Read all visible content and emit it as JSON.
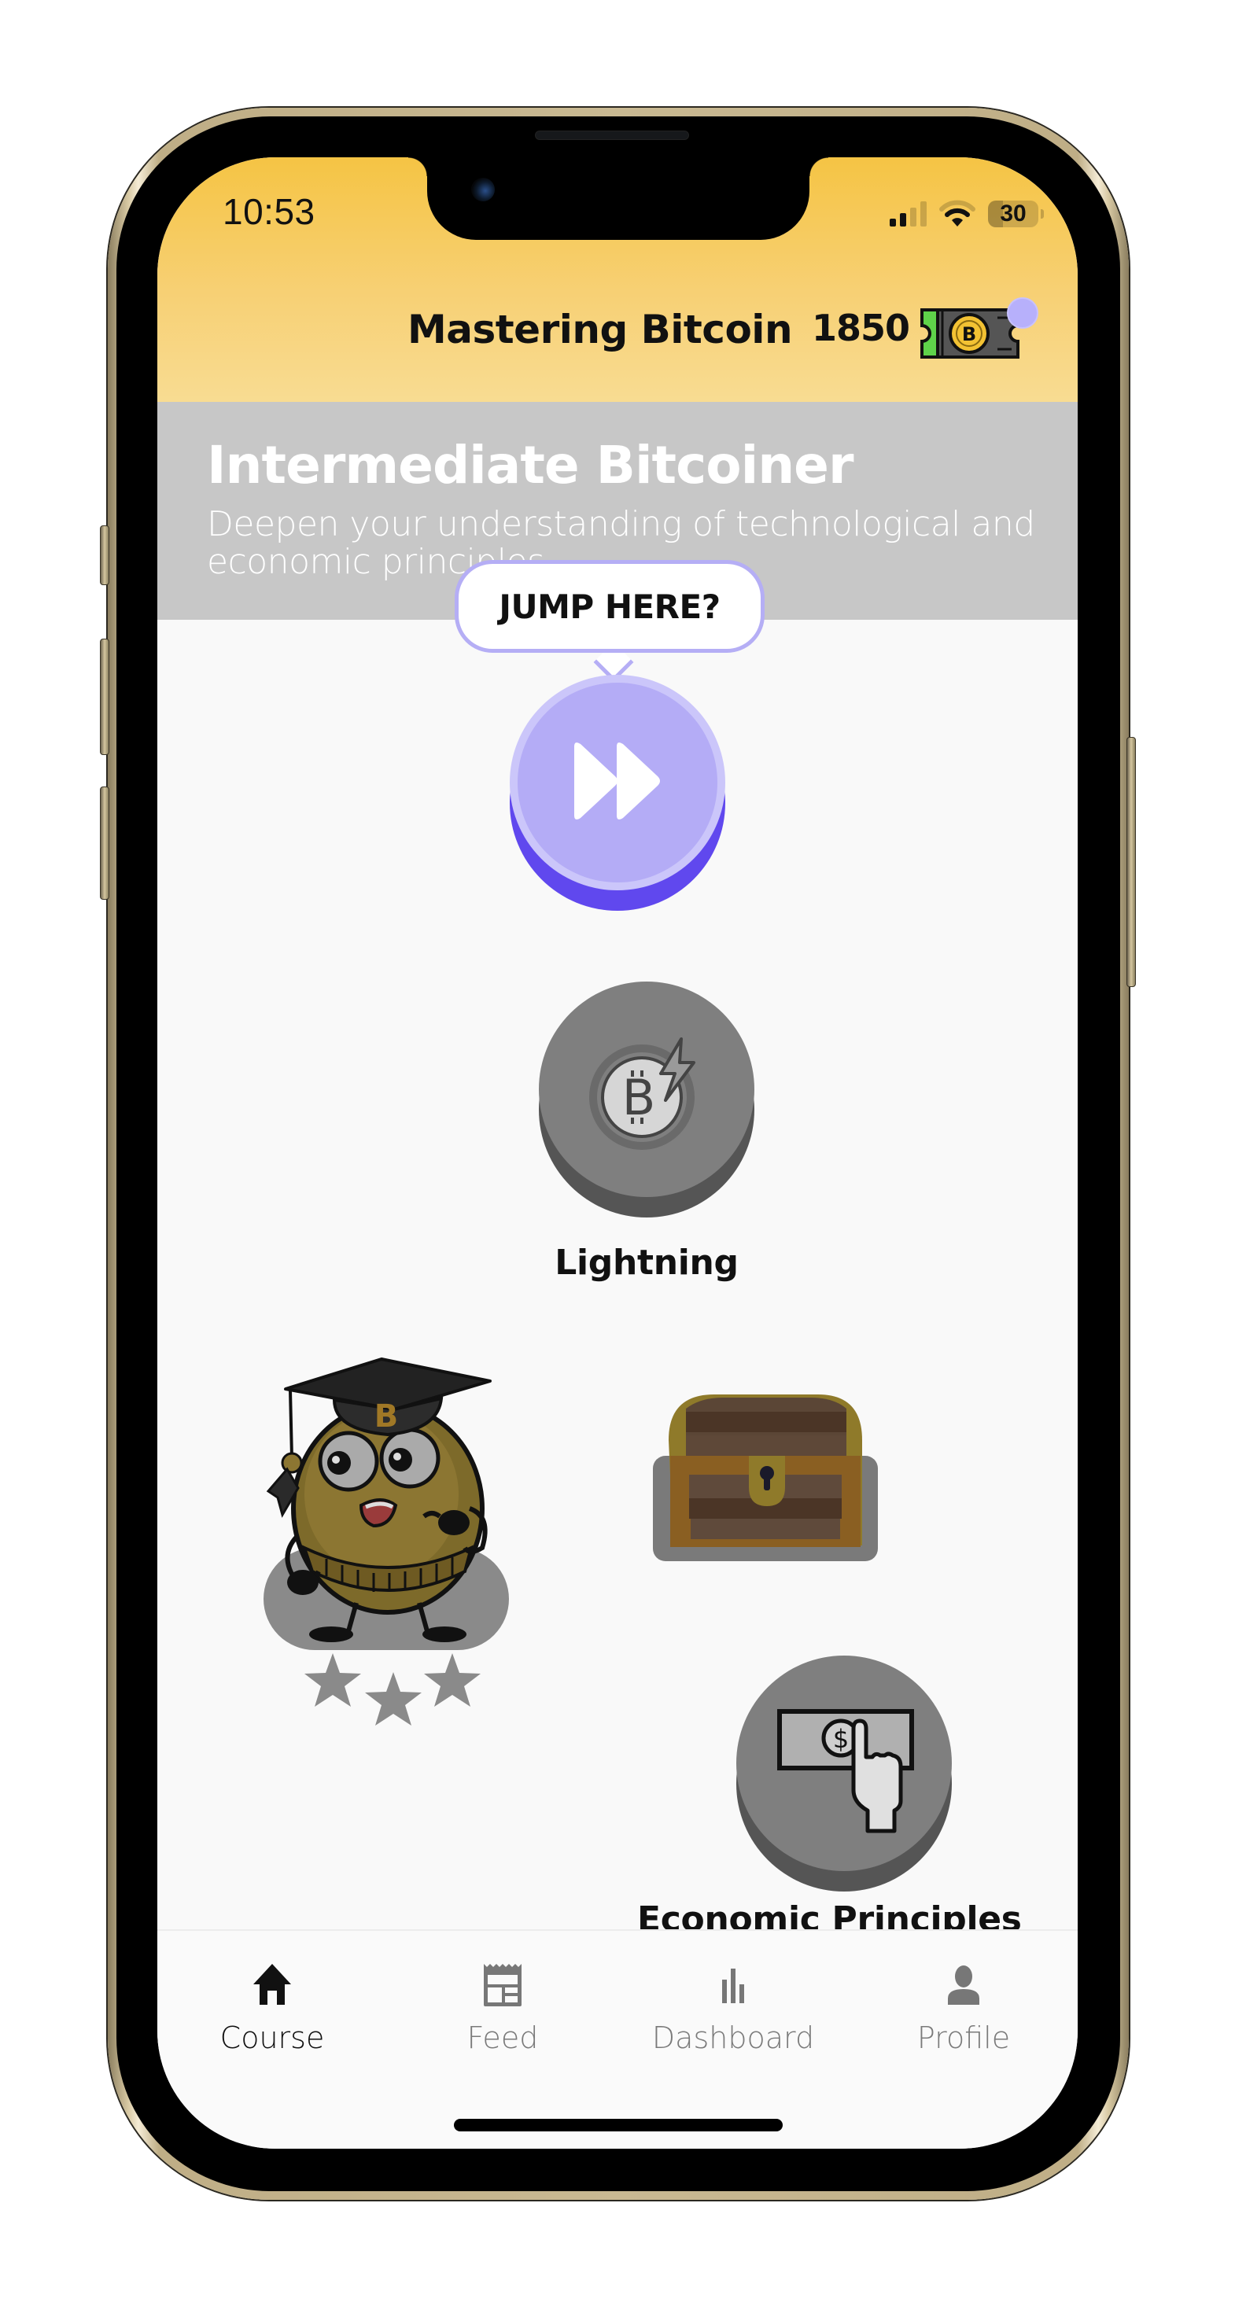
{
  "status_bar": {
    "time": "10:53",
    "battery_level": "30",
    "signal_bars_active": 2,
    "signal_bars_total": 4,
    "wifi": "wifi-icon"
  },
  "header": {
    "course_title": "Mastering Bitcoin",
    "points": "1850",
    "ticket_icon": "bitcoin-ticket-icon",
    "notification_dot_color": "#b7b0fb"
  },
  "banner": {
    "title": "Intermediate Bitcoiner",
    "subtitle": "Deepen your understanding of technological and economic principles."
  },
  "path": {
    "jump_bubble": "JUMP HERE?",
    "jump_icon": "fast-forward-icon",
    "nodes": [
      {
        "label": "Lightning",
        "icon": "bitcoin-lightning-icon",
        "state": "locked"
      },
      {
        "label": "",
        "icon": "graduate-mascot",
        "state": "locked",
        "stars": 3
      },
      {
        "label": "",
        "icon": "treasure-chest-icon",
        "state": "locked"
      },
      {
        "label": "Economic Principles",
        "icon": "cash-hand-icon",
        "state": "locked"
      }
    ]
  },
  "colors": {
    "header_gradient_top": "#f5c444",
    "header_gradient_bottom": "#f8dc92",
    "banner_bg": "#c7c7c7",
    "jump_accent": "#b4acf6",
    "jump_shadow": "#6048ee",
    "locked_node": "#7f7f7f"
  },
  "tabbar": {
    "tabs": [
      {
        "label": "Course",
        "icon": "home-icon",
        "active": true
      },
      {
        "label": "Feed",
        "icon": "newspaper-icon",
        "active": false
      },
      {
        "label": "Dashboard",
        "icon": "bar-chart-icon",
        "active": false
      },
      {
        "label": "Profile",
        "icon": "person-icon",
        "active": false
      }
    ]
  }
}
